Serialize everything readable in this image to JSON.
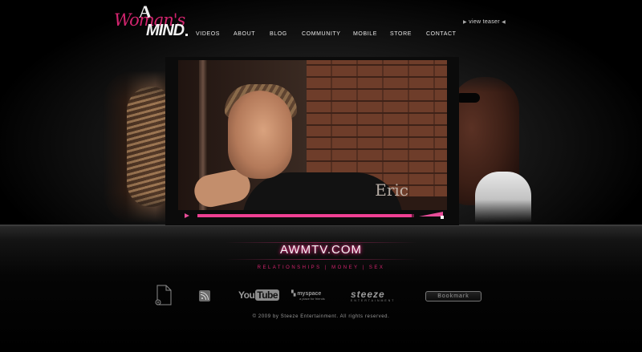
{
  "logo": {
    "line1": "A",
    "line2": "Woman's",
    "line3": "MIND"
  },
  "nav": {
    "items": [
      "VIDEOS",
      "ABOUT",
      "BLOG",
      "COMMUNITY",
      "MOBILE",
      "STORE",
      "CONTACT"
    ]
  },
  "teaser": {
    "label": "view teaser"
  },
  "video": {
    "caption": "Eric",
    "progress": 0.99
  },
  "site": {
    "name": "AWMTV.COM",
    "tagline": "RELATIONSHIPS | MONEY | SEX"
  },
  "footer_links": {
    "youtube_a": "You",
    "youtube_b": "Tube",
    "myspace": "myspace",
    "myspace_tag": "a place for friends",
    "steeze": "steeze",
    "steeze_sub": "ENTERTAINMENT",
    "bookmark": "Bookmark"
  },
  "copyright": "© 2009 by Steeze Entertainment. All rights reserved.",
  "colors": {
    "accent": "#d2246e",
    "progress": "#ee3f92"
  }
}
